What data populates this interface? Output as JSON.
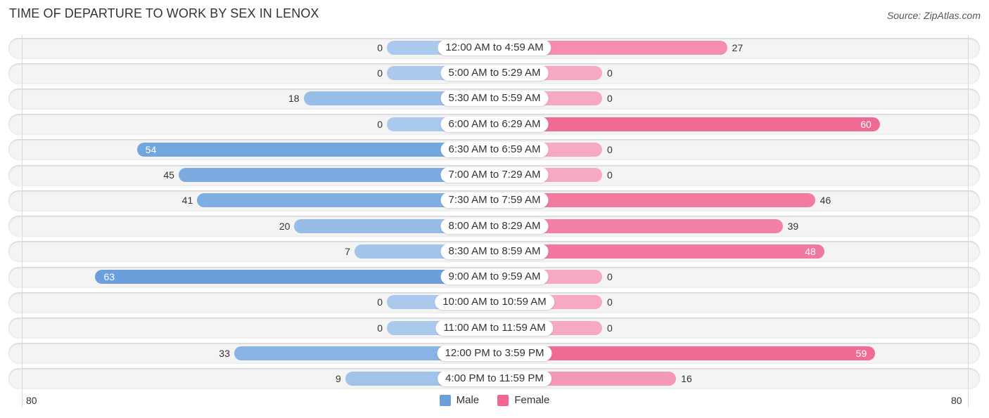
{
  "title": "TIME OF DEPARTURE TO WORK BY SEX IN LENOX",
  "source": "Source: ZipAtlas.com",
  "colors": {
    "male": "#6a9fdc",
    "male_light": "#aac9ec",
    "female": "#f06892",
    "female_light": "#f7a9c3"
  },
  "chart_data": {
    "type": "bar",
    "orientation": "horizontal-diverging",
    "title": "TIME OF DEPARTURE TO WORK BY SEX IN LENOX",
    "categories": [
      "12:00 AM to 4:59 AM",
      "5:00 AM to 5:29 AM",
      "5:30 AM to 5:59 AM",
      "6:00 AM to 6:29 AM",
      "6:30 AM to 6:59 AM",
      "7:00 AM to 7:29 AM",
      "7:30 AM to 7:59 AM",
      "8:00 AM to 8:29 AM",
      "8:30 AM to 8:59 AM",
      "9:00 AM to 9:59 AM",
      "10:00 AM to 10:59 AM",
      "11:00 AM to 11:59 AM",
      "12:00 PM to 3:59 PM",
      "4:00 PM to 11:59 PM"
    ],
    "series": [
      {
        "name": "Male",
        "values": [
          0,
          0,
          18,
          0,
          54,
          45,
          41,
          20,
          7,
          63,
          0,
          0,
          33,
          9
        ]
      },
      {
        "name": "Female",
        "values": [
          27,
          0,
          0,
          60,
          0,
          0,
          46,
          39,
          48,
          0,
          0,
          0,
          59,
          16
        ]
      }
    ],
    "xlim": [
      -80,
      80
    ],
    "tick_labels": {
      "left": "80",
      "right": "80"
    },
    "legend": {
      "position": "bottom-center",
      "entries": [
        "Male",
        "Female"
      ]
    },
    "grid": false
  }
}
